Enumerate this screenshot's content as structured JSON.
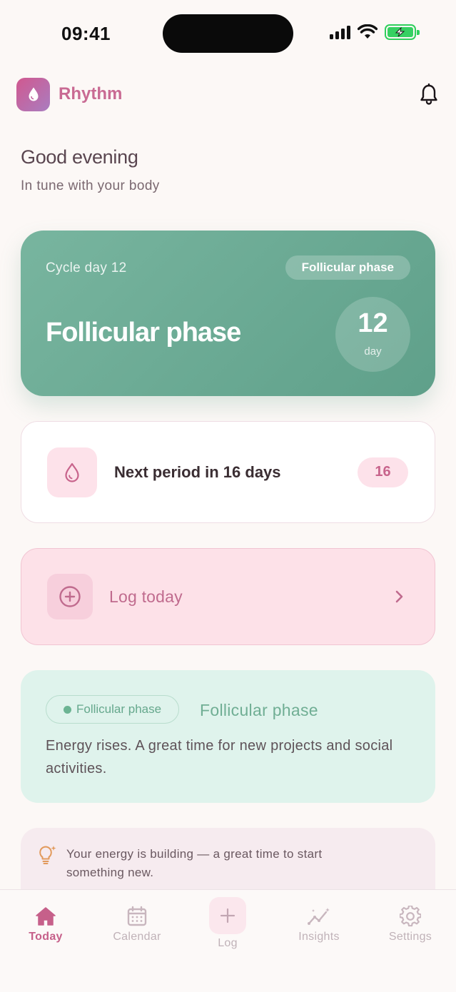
{
  "status_bar": {
    "time": "09:41"
  },
  "header": {
    "app_name": "Rhythm",
    "logo_icon": "droplet-icon",
    "notification_icon": "bell-icon"
  },
  "greeting": {
    "title": "Good evening",
    "subtitle": "In tune with your body"
  },
  "cycle": {
    "day_label": "Cycle day 12",
    "phase_badge": "Follicular phase",
    "phase_title": "Follicular phase",
    "day_number": "12",
    "day_unit": "day"
  },
  "next_period": {
    "text": "Next period in 16 days",
    "days": "16",
    "icon": "droplet-icon"
  },
  "log_today": {
    "label": "Log today",
    "icon": "plus-circle-icon"
  },
  "phase_info": {
    "chip": "Follicular phase",
    "name": "Follicular phase",
    "description": "Energy rises. A great time for new projects and social activities."
  },
  "tip": {
    "icon": "lightbulb-icon",
    "text": "Your energy is building — a great time to start something new."
  },
  "nav": {
    "today": "Today",
    "calendar": "Calendar",
    "log": "Log",
    "insights": "Insights",
    "settings": "Settings"
  },
  "colors": {
    "accent": "#c6608a",
    "hero_green": "#6aaa93",
    "mint_bg": "#dff3ec",
    "pink_bg": "#fde1e8",
    "page_bg": "#fcf8f6"
  }
}
